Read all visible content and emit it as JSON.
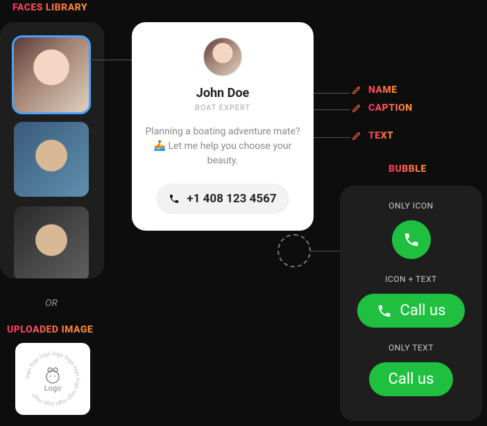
{
  "headings": {
    "faces_library": "FACES LIBRARY",
    "or": "OR",
    "uploaded_image": "UPLOADED IMAGE",
    "bubble": "BUBBLE"
  },
  "card": {
    "name": "John Doe",
    "caption": "BOAT EXPERT",
    "text": "Planning a boating adventure mate? 🚣 Let me help you choose your beauty.",
    "phone": "+1 408 123 4567"
  },
  "edit": {
    "name": "NAME",
    "caption": "CAPTION",
    "text": "TEXT"
  },
  "bubble": {
    "only_icon": "ONLY ICON",
    "icon_text": "ICON + TEXT",
    "only_text": "ONLY TEXT",
    "call_us": "Call us"
  },
  "logo": {
    "label": "Logo"
  },
  "colors": {
    "accent_green": "#1fbf3f"
  }
}
